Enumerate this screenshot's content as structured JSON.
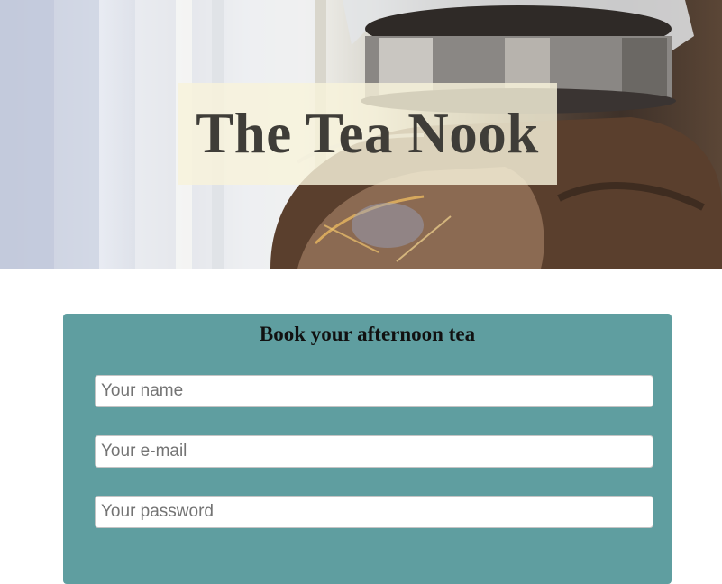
{
  "hero": {
    "title": "The Tea Nook",
    "image_description": "glass-teapot-photo"
  },
  "booking_form": {
    "heading": "Book your afternoon tea",
    "name_placeholder": "Your name",
    "email_placeholder": "Your e-mail",
    "password_placeholder": "Your password",
    "background_color": "#5f9ea0"
  }
}
